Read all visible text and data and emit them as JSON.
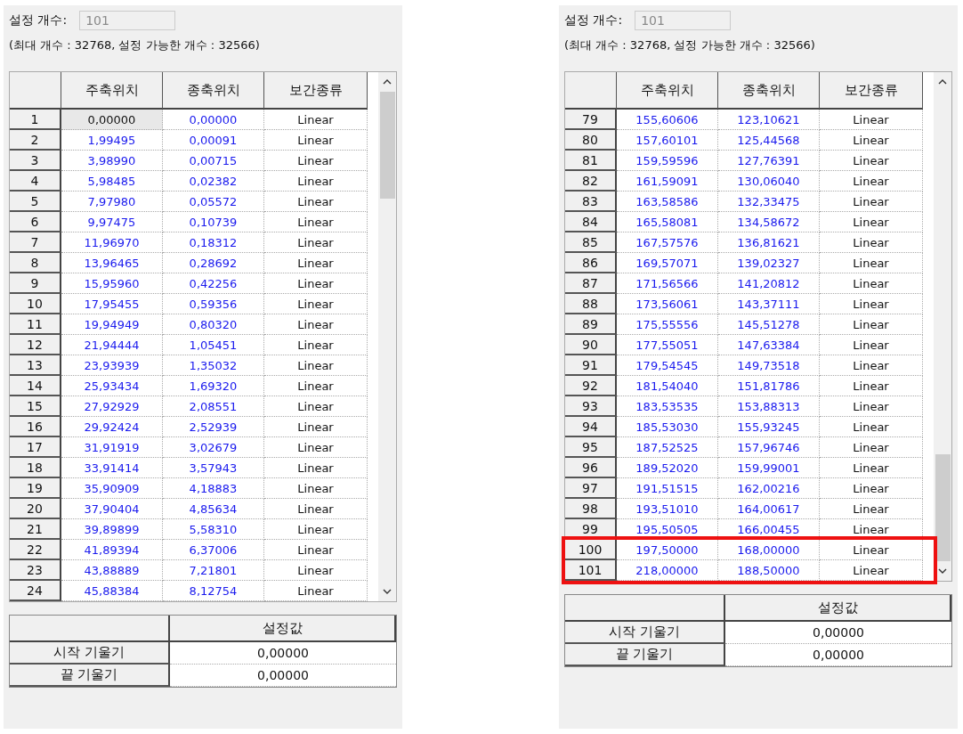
{
  "panels": [
    {
      "count_label": "설정 개수:",
      "count_field": {
        "value": "101",
        "disabled": true
      },
      "info": "(최대 개수 : 32768, 설정 가능한 개수 : 32566)",
      "table": {
        "columns": [
          "주축위치",
          "종축위치",
          "보간종류"
        ],
        "rows": [
          {
            "no": "1",
            "main": "0,00000",
            "sub": "0,00000",
            "interp": "Linear",
            "selected": true,
            "highlighted": false
          },
          {
            "no": "2",
            "main": "1,99495",
            "sub": "0,00091",
            "interp": "Linear",
            "selected": false,
            "highlighted": false
          },
          {
            "no": "3",
            "main": "3,98990",
            "sub": "0,00715",
            "interp": "Linear",
            "selected": false,
            "highlighted": false
          },
          {
            "no": "4",
            "main": "5,98485",
            "sub": "0,02382",
            "interp": "Linear",
            "selected": false,
            "highlighted": false
          },
          {
            "no": "5",
            "main": "7,97980",
            "sub": "0,05572",
            "interp": "Linear",
            "selected": false,
            "highlighted": false
          },
          {
            "no": "6",
            "main": "9,97475",
            "sub": "0,10739",
            "interp": "Linear",
            "selected": false,
            "highlighted": false
          },
          {
            "no": "7",
            "main": "11,96970",
            "sub": "0,18312",
            "interp": "Linear",
            "selected": false,
            "highlighted": false
          },
          {
            "no": "8",
            "main": "13,96465",
            "sub": "0,28692",
            "interp": "Linear",
            "selected": false,
            "highlighted": false
          },
          {
            "no": "9",
            "main": "15,95960",
            "sub": "0,42256",
            "interp": "Linear",
            "selected": false,
            "highlighted": false
          },
          {
            "no": "10",
            "main": "17,95455",
            "sub": "0,59356",
            "interp": "Linear",
            "selected": false,
            "highlighted": false
          },
          {
            "no": "11",
            "main": "19,94949",
            "sub": "0,80320",
            "interp": "Linear",
            "selected": false,
            "highlighted": false
          },
          {
            "no": "12",
            "main": "21,94444",
            "sub": "1,05451",
            "interp": "Linear",
            "selected": false,
            "highlighted": false
          },
          {
            "no": "13",
            "main": "23,93939",
            "sub": "1,35032",
            "interp": "Linear",
            "selected": false,
            "highlighted": false
          },
          {
            "no": "14",
            "main": "25,93434",
            "sub": "1,69320",
            "interp": "Linear",
            "selected": false,
            "highlighted": false
          },
          {
            "no": "15",
            "main": "27,92929",
            "sub": "2,08551",
            "interp": "Linear",
            "selected": false,
            "highlighted": false
          },
          {
            "no": "16",
            "main": "29,92424",
            "sub": "2,52939",
            "interp": "Linear",
            "selected": false,
            "highlighted": false
          },
          {
            "no": "17",
            "main": "31,91919",
            "sub": "3,02679",
            "interp": "Linear",
            "selected": false,
            "highlighted": false
          },
          {
            "no": "18",
            "main": "33,91414",
            "sub": "3,57943",
            "interp": "Linear",
            "selected": false,
            "highlighted": false
          },
          {
            "no": "19",
            "main": "35,90909",
            "sub": "4,18883",
            "interp": "Linear",
            "selected": false,
            "highlighted": false
          },
          {
            "no": "20",
            "main": "37,90404",
            "sub": "4,85634",
            "interp": "Linear",
            "selected": false,
            "highlighted": false
          },
          {
            "no": "21",
            "main": "39,89899",
            "sub": "5,58310",
            "interp": "Linear",
            "selected": false,
            "highlighted": false
          },
          {
            "no": "22",
            "main": "41,89394",
            "sub": "6,37006",
            "interp": "Linear",
            "selected": false,
            "highlighted": false
          },
          {
            "no": "23",
            "main": "43,88889",
            "sub": "7,21801",
            "interp": "Linear",
            "selected": false,
            "highlighted": false
          },
          {
            "no": "24",
            "main": "45,88384",
            "sub": "8,12754",
            "interp": "Linear",
            "selected": false,
            "highlighted": false
          }
        ]
      },
      "slopes": {
        "header": "설정값",
        "rows": [
          {
            "label": "시작 기울기",
            "value": "0,00000"
          },
          {
            "label": "끝 기울기",
            "value": "0,00000"
          }
        ]
      }
    },
    {
      "count_label": "설정 개수:",
      "count_field": {
        "value": "101",
        "disabled": true
      },
      "info": "(최대 개수 : 32768, 설정 가능한 개수 : 32566)",
      "table": {
        "columns": [
          "주축위치",
          "종축위치",
          "보간종류"
        ],
        "rows": [
          {
            "no": "79",
            "main": "155,60606",
            "sub": "123,10621",
            "interp": "Linear",
            "selected": false,
            "highlighted": false
          },
          {
            "no": "80",
            "main": "157,60101",
            "sub": "125,44568",
            "interp": "Linear",
            "selected": false,
            "highlighted": false
          },
          {
            "no": "81",
            "main": "159,59596",
            "sub": "127,76391",
            "interp": "Linear",
            "selected": false,
            "highlighted": false
          },
          {
            "no": "82",
            "main": "161,59091",
            "sub": "130,06040",
            "interp": "Linear",
            "selected": false,
            "highlighted": false
          },
          {
            "no": "83",
            "main": "163,58586",
            "sub": "132,33475",
            "interp": "Linear",
            "selected": false,
            "highlighted": false
          },
          {
            "no": "84",
            "main": "165,58081",
            "sub": "134,58672",
            "interp": "Linear",
            "selected": false,
            "highlighted": false
          },
          {
            "no": "85",
            "main": "167,57576",
            "sub": "136,81621",
            "interp": "Linear",
            "selected": false,
            "highlighted": false
          },
          {
            "no": "86",
            "main": "169,57071",
            "sub": "139,02327",
            "interp": "Linear",
            "selected": false,
            "highlighted": false
          },
          {
            "no": "87",
            "main": "171,56566",
            "sub": "141,20812",
            "interp": "Linear",
            "selected": false,
            "highlighted": false
          },
          {
            "no": "88",
            "main": "173,56061",
            "sub": "143,37111",
            "interp": "Linear",
            "selected": false,
            "highlighted": false
          },
          {
            "no": "89",
            "main": "175,55556",
            "sub": "145,51278",
            "interp": "Linear",
            "selected": false,
            "highlighted": false
          },
          {
            "no": "90",
            "main": "177,55051",
            "sub": "147,63384",
            "interp": "Linear",
            "selected": false,
            "highlighted": false
          },
          {
            "no": "91",
            "main": "179,54545",
            "sub": "149,73518",
            "interp": "Linear",
            "selected": false,
            "highlighted": false
          },
          {
            "no": "92",
            "main": "181,54040",
            "sub": "151,81786",
            "interp": "Linear",
            "selected": false,
            "highlighted": false
          },
          {
            "no": "93",
            "main": "183,53535",
            "sub": "153,88313",
            "interp": "Linear",
            "selected": false,
            "highlighted": false
          },
          {
            "no": "94",
            "main": "185,53030",
            "sub": "155,93245",
            "interp": "Linear",
            "selected": false,
            "highlighted": false
          },
          {
            "no": "95",
            "main": "187,52525",
            "sub": "157,96746",
            "interp": "Linear",
            "selected": false,
            "highlighted": false
          },
          {
            "no": "96",
            "main": "189,52020",
            "sub": "159,99001",
            "interp": "Linear",
            "selected": false,
            "highlighted": false
          },
          {
            "no": "97",
            "main": "191,51515",
            "sub": "162,00216",
            "interp": "Linear",
            "selected": false,
            "highlighted": false
          },
          {
            "no": "98",
            "main": "193,51010",
            "sub": "164,00617",
            "interp": "Linear",
            "selected": false,
            "highlighted": false
          },
          {
            "no": "99",
            "main": "195,50505",
            "sub": "166,00455",
            "interp": "Linear",
            "selected": false,
            "highlighted": false
          },
          {
            "no": "100",
            "main": "197,50000",
            "sub": "168,00000",
            "interp": "Linear",
            "selected": false,
            "highlighted": true
          },
          {
            "no": "101",
            "main": "218,00000",
            "sub": "188,50000",
            "interp": "Linear",
            "selected": false,
            "highlighted": true
          }
        ]
      },
      "slopes": {
        "header": "설정값",
        "rows": [
          {
            "label": "시작 기울기",
            "value": "0,00000"
          },
          {
            "label": "끝 기울기",
            "value": "0,00000"
          }
        ]
      }
    }
  ]
}
